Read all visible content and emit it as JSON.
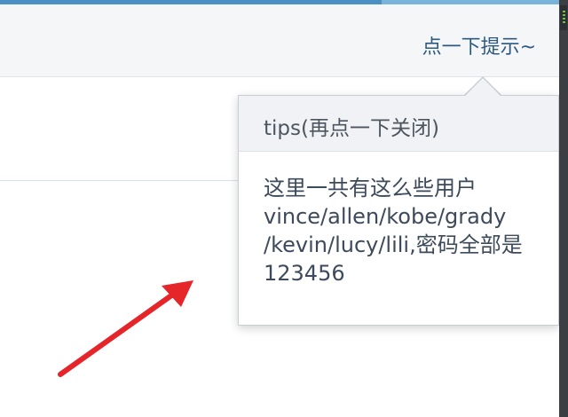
{
  "header": {
    "hint_link": "点一下提示~"
  },
  "popover": {
    "title": "tips(再点一下关闭)",
    "body_lines": [
      "这里一共有这么些用户",
      "vince/allen/kobe/grady",
      "/kevin/lucy/lili,密码全部是",
      "123456"
    ]
  },
  "annotation": {
    "arrow_color": "#e5252a"
  },
  "colors": {
    "accent": "#4a90c4",
    "link": "#2d5a80"
  }
}
